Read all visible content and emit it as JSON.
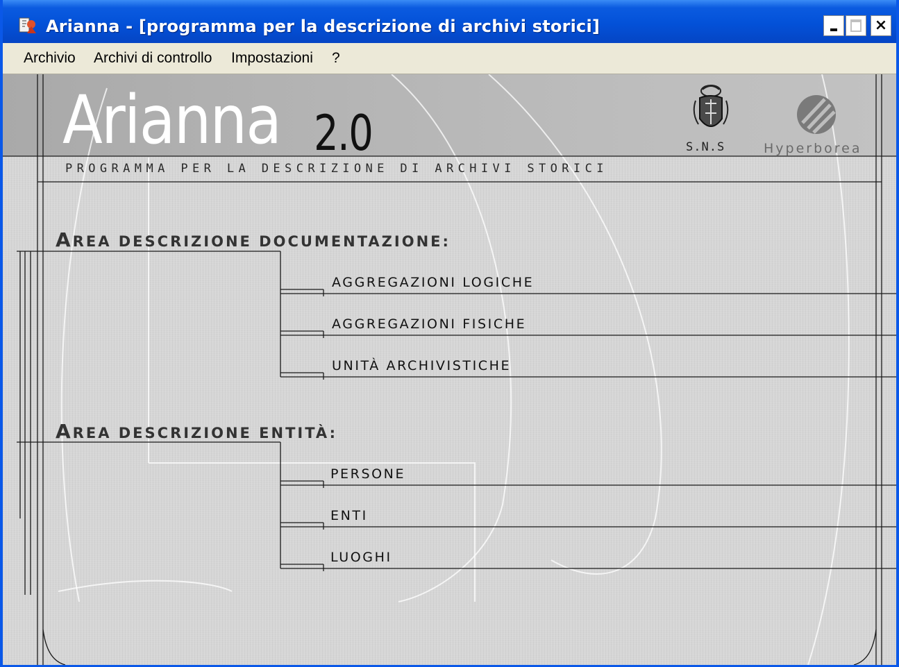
{
  "window": {
    "title": "Arianna - [programma per la descrizione di archivi storici]",
    "buttons": {
      "minimize": "_",
      "maximize": "□",
      "close": "×"
    }
  },
  "menubar": {
    "items": [
      "Archivio",
      "Archivi di controllo",
      "Impostazioni",
      "?"
    ]
  },
  "banner": {
    "logo_name": "Arianna",
    "logo_version": "2.0",
    "subtitle": "PROGRAMMA PER LA DESCRIZIONE DI ARCHIVI STORICI",
    "partners": [
      {
        "label": "S.N.S",
        "icon": "sns-crest-icon"
      },
      {
        "label": "Hyperborea",
        "icon": "hyperborea-logo-icon"
      }
    ]
  },
  "areas": [
    {
      "heading_initial": "A",
      "heading_rest": "rea descrizione documentazione:",
      "links": [
        "Aggregazioni logiche",
        "Aggregazioni fisiche",
        "Unità archivistiche"
      ]
    },
    {
      "heading_initial": "A",
      "heading_rest": "rea descrizione entità:",
      "links": [
        "Persone",
        "Enti",
        "Luoghi"
      ]
    }
  ],
  "colors": {
    "titlebar": "#0351d8",
    "window_border": "#0a58e8",
    "menubar": "#ece9d8",
    "content_bg": "#d6d6d6",
    "banner_bg": "#b5b5b5",
    "line": "#1a1a1a"
  }
}
